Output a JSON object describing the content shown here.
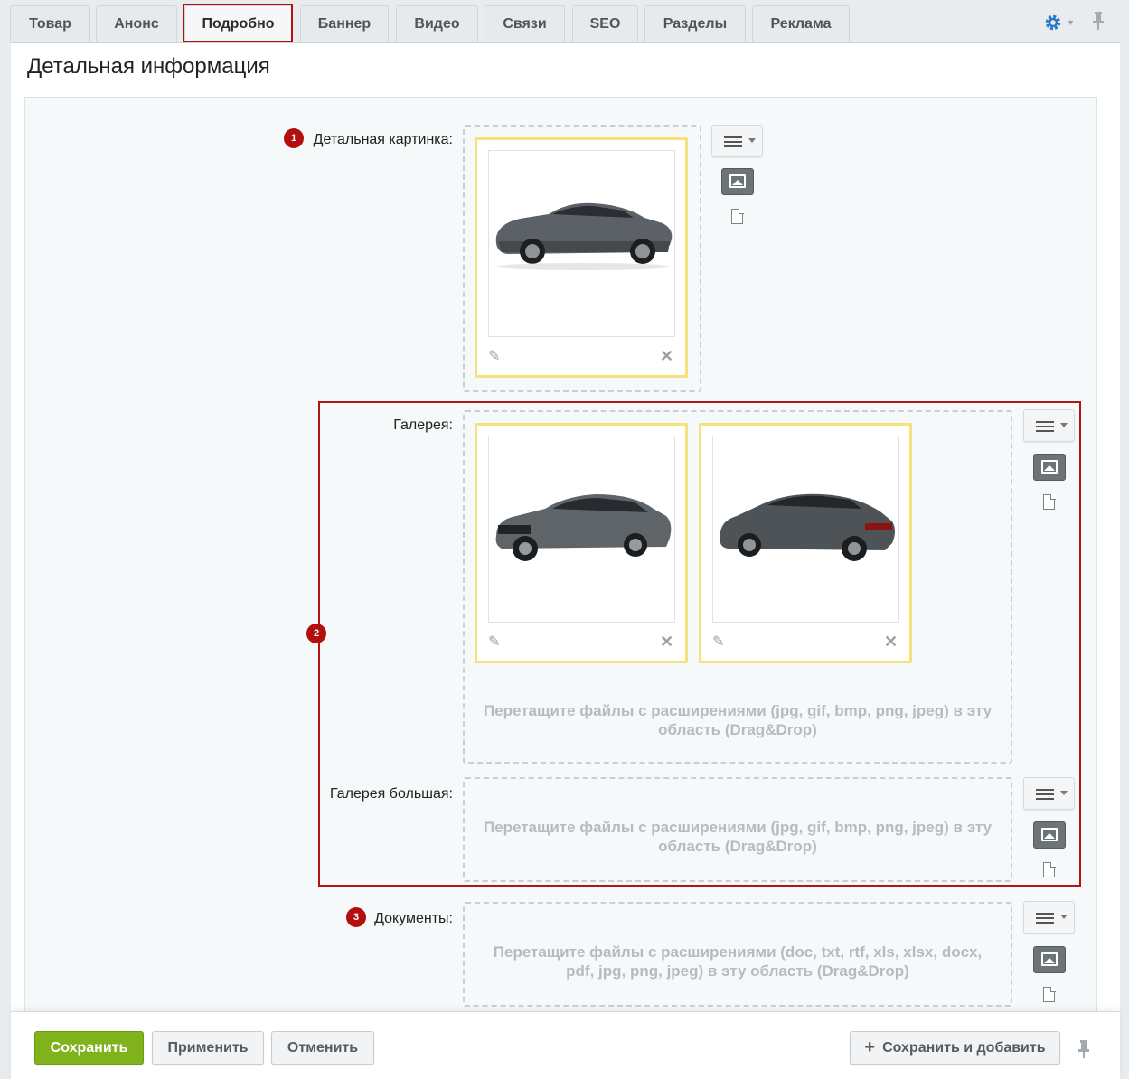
{
  "tabs": [
    {
      "label": "Товар",
      "active": false
    },
    {
      "label": "Анонс",
      "active": false
    },
    {
      "label": "Подробно",
      "active": true
    },
    {
      "label": "Баннер",
      "active": false
    },
    {
      "label": "Видео",
      "active": false
    },
    {
      "label": "Связи",
      "active": false
    },
    {
      "label": "SEO",
      "active": false
    },
    {
      "label": "Разделы",
      "active": false
    },
    {
      "label": "Реклама",
      "active": false
    }
  ],
  "page_title": "Детальная информация",
  "fields": {
    "detail_picture": {
      "label": "Детальная картинка:",
      "badge": "1"
    },
    "gallery": {
      "label": "Галерея:",
      "badge": "2",
      "drop_text": "Перетащите файлы с расширениями (jpg, gif, bmp, png, jpeg) в эту область (Drag&Drop)"
    },
    "gallery_big": {
      "label": "Галерея большая:",
      "drop_text": "Перетащите файлы с расширениями (jpg, gif, bmp, png, jpeg) в эту область (Drag&Drop)"
    },
    "documents": {
      "label": "Документы:",
      "badge": "3",
      "drop_text": "Перетащите файлы с расширениями (doc, txt, rtf, xls, xlsx, docx, pdf, jpg, png, jpeg) в эту область (Drag&Drop)"
    }
  },
  "icons": {
    "settings": "gear-icon",
    "pin": "pin-icon",
    "menu": "hamburger-menu-icon",
    "image": "image-icon",
    "file": "file-icon",
    "edit": "pencil-icon",
    "delete": "close-icon"
  },
  "footer": {
    "save": "Сохранить",
    "apply": "Применить",
    "cancel": "Отменить",
    "save_add": "Сохранить и добавить"
  },
  "colors": {
    "accent_red": "#b30f0f",
    "save_green": "#7fb21b",
    "thumb_border": "#f5e27a",
    "settings_blue": "#2a7ac9"
  }
}
